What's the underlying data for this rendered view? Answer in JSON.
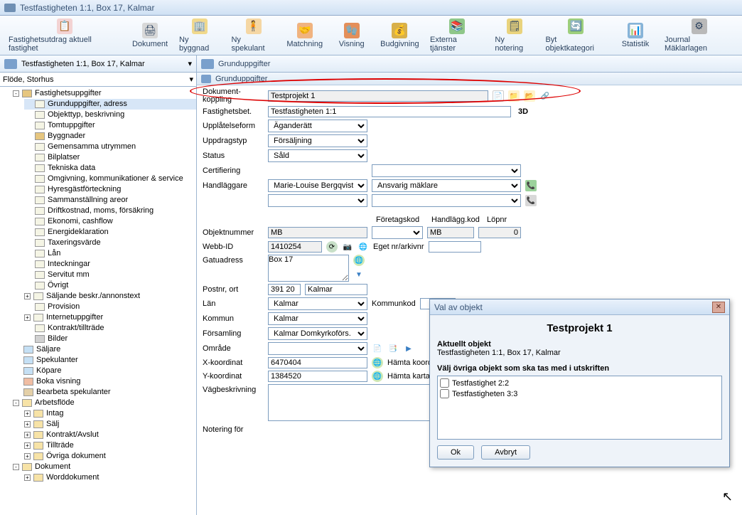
{
  "titlebar": {
    "title": "Testfastigheten 1:1, Box 17, Kalmar"
  },
  "toolbar": [
    {
      "label": "Fastighetsutdrag aktuell fastighet",
      "icon": "📋",
      "bg": "#f3d3d3"
    },
    {
      "label": "Dokument",
      "icon": "🖨",
      "bg": "#d8d8d8"
    },
    {
      "label": "Ny byggnad",
      "icon": "🏢",
      "bg": "#f0d98c"
    },
    {
      "label": "Ny spekulant",
      "icon": "🧍",
      "bg": "#f5d7a4"
    },
    {
      "label": "Matchning",
      "icon": "🤝",
      "bg": "#f0b380"
    },
    {
      "label": "Visning",
      "icon": "🧤",
      "bg": "#e48f5a"
    },
    {
      "label": "Budgivning",
      "icon": "💰",
      "bg": "#d8b04a"
    },
    {
      "label": "Externa tjänster",
      "icon": "📚",
      "bg": "#8fc789"
    },
    {
      "label": "Ny notering",
      "icon": "🗒",
      "bg": "#e9d37d"
    },
    {
      "label": "Byt objektkategori",
      "icon": "🔄",
      "bg": "#9dcf7c"
    },
    {
      "label": "Statistik",
      "icon": "📊",
      "bg": "#86b4d9"
    },
    {
      "label": "Journal Mäklarlagen",
      "icon": "⚙",
      "bg": "#b9b9b9"
    }
  ],
  "left": {
    "header": "Testfastigheten 1:1, Box 17, Kalmar",
    "combo": "Flöde, Storhus",
    "tree": [
      {
        "t": "Fastighetsuppgifter",
        "cls": "ic-house",
        "exp": "-",
        "children": [
          {
            "t": "Grunduppgifter, adress",
            "cls": "ic-page",
            "sel": true
          },
          {
            "t": "Objekttyp, beskrivning",
            "cls": "ic-page"
          },
          {
            "t": "Tomtuppgifter",
            "cls": "ic-page"
          },
          {
            "t": "Byggnader",
            "cls": "ic-house"
          },
          {
            "t": "Gemensamma utrymmen",
            "cls": "ic-page"
          },
          {
            "t": "Bilplatser",
            "cls": "ic-page"
          },
          {
            "t": "Tekniska data",
            "cls": "ic-page"
          },
          {
            "t": "Omgivning, kommunikationer & service",
            "cls": "ic-page"
          },
          {
            "t": "Hyresgästförteckning",
            "cls": "ic-page"
          },
          {
            "t": "Sammanställning areor",
            "cls": "ic-page"
          },
          {
            "t": "Driftkostnad, moms, försäkring",
            "cls": "ic-page"
          },
          {
            "t": "Ekonomi, cashflow",
            "cls": "ic-page"
          },
          {
            "t": "Energideklaration",
            "cls": "ic-page"
          },
          {
            "t": "Taxeringsvärde",
            "cls": "ic-page"
          },
          {
            "t": "Lån",
            "cls": "ic-page"
          },
          {
            "t": "Inteckningar",
            "cls": "ic-page"
          },
          {
            "t": "Servitut mm",
            "cls": "ic-page"
          },
          {
            "t": "Övrigt",
            "cls": "ic-page"
          },
          {
            "t": "Säljande beskr./annonstext",
            "cls": "ic-page",
            "exp": "+"
          },
          {
            "t": "Provision",
            "cls": "ic-page"
          },
          {
            "t": "Internetuppgifter",
            "cls": "ic-page",
            "exp": "+"
          },
          {
            "t": "Kontrakt/tillträde",
            "cls": "ic-page"
          },
          {
            "t": "Bilder",
            "cls": "ic-img"
          }
        ]
      },
      {
        "t": "Säljare",
        "cls": "ic-people"
      },
      {
        "t": "Spekulanter",
        "cls": "ic-people"
      },
      {
        "t": "Köpare",
        "cls": "ic-people"
      },
      {
        "t": "Boka visning",
        "cls": "ic-book"
      },
      {
        "t": "Bearbeta spekulanter",
        "cls": "ic-gear"
      },
      {
        "t": "Arbetsflöde",
        "cls": "ic-folder",
        "exp": "-",
        "children": [
          {
            "t": "Intag",
            "cls": "ic-folder",
            "exp": "+"
          },
          {
            "t": "Sälj",
            "cls": "ic-folder",
            "exp": "+"
          },
          {
            "t": "Kontrakt/Avslut",
            "cls": "ic-folder",
            "exp": "+"
          },
          {
            "t": "Tillträde",
            "cls": "ic-folder",
            "exp": "+"
          },
          {
            "t": "Övriga dokument",
            "cls": "ic-folder",
            "exp": "+"
          }
        ]
      },
      {
        "t": "Dokument",
        "cls": "ic-folder",
        "exp": "-",
        "children": [
          {
            "t": "Worddokument",
            "cls": "ic-folder",
            "exp": "+"
          }
        ]
      }
    ]
  },
  "right": {
    "header": "Grunduppgifter",
    "subheader": "Grunduppgifter",
    "fields": {
      "dokumentkoppling_lbl": "Dokument-\nkoppling",
      "dokumentkoppling": "Testprojekt 1",
      "fastighetsbet_lbl": "Fastighetsbet.",
      "fastighetsbet": "Testfastigheten 1:1",
      "threeD": "3D",
      "upplatelseform_lbl": "Upplåtelseform",
      "upplatelseform": "Äganderätt",
      "uppdragstyp_lbl": "Uppdragstyp",
      "uppdragstyp": "Försäljning",
      "status_lbl": "Status",
      "status": "Såld",
      "certifiering_lbl": "Certifiering",
      "handlaggare_lbl": "Handläggare",
      "handlaggare": "Marie-Louise Bergqvist",
      "ansvarig": "Ansvarig mäklare",
      "foretagskod_lbl": "Företagskod",
      "handlaggkod_lbl": "Handlägg.kod",
      "handlaggkod": "MB",
      "lopnr_lbl": "Löpnr",
      "lopnr": "0",
      "objektnummer_lbl": "Objektnummer",
      "objektnummer": "MB",
      "webbid_lbl": "Webb-ID",
      "webbid": "1410254",
      "egetnr_lbl": "Eget nr/arkivnr",
      "gatuadress_lbl": "Gatuadress",
      "gatuadress": "Box 17",
      "postnr_lbl": "Postnr, ort",
      "postnr": "391 20",
      "ort": "Kalmar",
      "lan_lbl": "Län",
      "lan": "Kalmar",
      "kommunkod_lbl": "Kommunkod",
      "kommun_lbl": "Kommun",
      "kommun": "Kalmar",
      "forsamling_lbl": "Församling",
      "forsamling": "Kalmar Domkyrkoförs.",
      "omrade_lbl": "Område",
      "xkoord_lbl": "X-koordinat",
      "xkoord": "6470404",
      "hamta_koord": "Hämta koordin",
      "ykoord_lbl": "Y-koordinat",
      "ykoord": "1384520",
      "hamta_karta": "Hämta karta",
      "vagbeskrivning_lbl": "Vägbeskrivning",
      "notering_lbl": "Notering för"
    }
  },
  "dialog": {
    "title": "Val av objekt",
    "heading": "Testprojekt 1",
    "aktuellt_title": "Aktuellt objekt",
    "aktuellt": "Testfastigheten 1:1, Box 17, Kalmar",
    "valj_title": "Välj övriga objekt som ska tas med i utskriften",
    "items": [
      "Testfastighet 2:2",
      "Testfastigheten 3:3"
    ],
    "ok": "Ok",
    "avbryt": "Avbryt"
  }
}
